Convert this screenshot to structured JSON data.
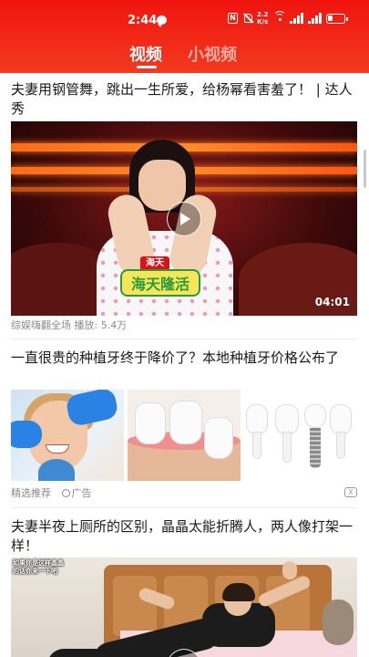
{
  "status_bar": {
    "time": "2:44",
    "network_speed": "2.2\nK/s",
    "battery": "low"
  },
  "tabs": [
    {
      "label": "视频",
      "active": true
    },
    {
      "label": "小视频",
      "active": false
    }
  ],
  "feed": [
    {
      "type": "video",
      "title": "夫妻用钢管舞，跳出一生所爱，给杨幂看害羞了！ | 达人秀",
      "duration": "04:01",
      "logo_top": "海天",
      "logo_bottom": "海天隆活",
      "source": "综娱嗨翻全场",
      "plays": "播放: 5.4万"
    },
    {
      "type": "ad",
      "title": "一直很贵的种植牙终于降价了？本地种植牙价格公布了",
      "source": "精选推荐",
      "ad_label": "广告",
      "close_label": "X"
    },
    {
      "type": "video",
      "title": "夫妻半夜上厕所的区别，晶晶太能折腾人，两人像打架一样！",
      "caption": "如果你是这样晶晶的话你来一下吧"
    }
  ],
  "colors": {
    "header_red": "#f0140f",
    "meta_gray": "#8a8a8a"
  }
}
